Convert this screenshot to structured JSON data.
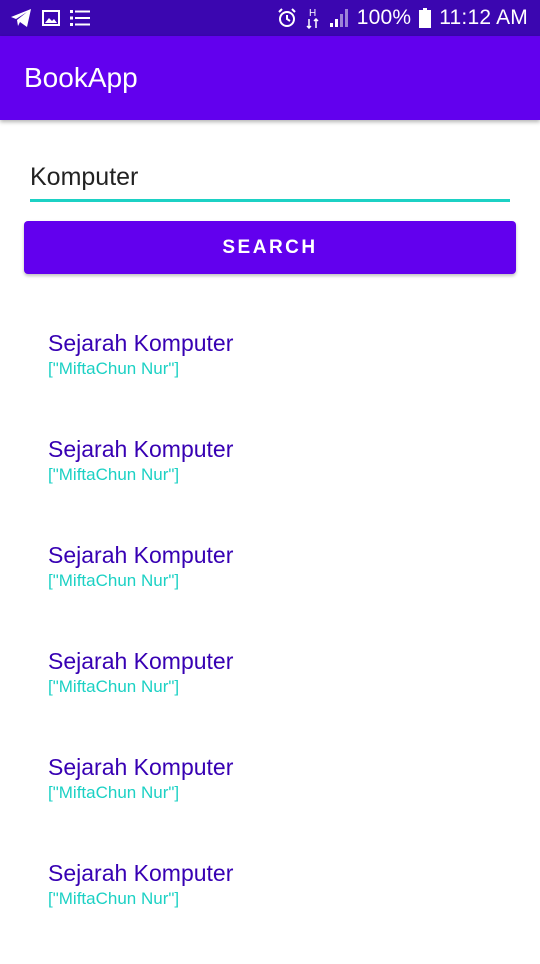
{
  "status_bar": {
    "battery_percent": "100%",
    "time": "11:12 AM",
    "network_label": "H",
    "left_icons": [
      "telegram-icon",
      "gallery-icon",
      "list-icon"
    ],
    "right_icons": [
      "alarm-icon",
      "data-arrows-icon",
      "signal-icon",
      "battery-icon"
    ]
  },
  "app_bar": {
    "title": "BookApp",
    "color": "#6200ee"
  },
  "search": {
    "value": "Komputer",
    "underline_color": "#1cd1c4",
    "button_label": "SEARCH"
  },
  "books": [
    {
      "title": "Sejarah Komputer",
      "authors": "[\"MiftaChun Nur\"]"
    },
    {
      "title": "Sejarah Komputer",
      "authors": "[\"MiftaChun Nur\"]"
    },
    {
      "title": "Sejarah Komputer",
      "authors": "[\"MiftaChun Nur\"]"
    },
    {
      "title": "Sejarah Komputer",
      "authors": "[\"MiftaChun Nur\"]"
    },
    {
      "title": "Sejarah Komputer",
      "authors": "[\"MiftaChun Nur\"]"
    },
    {
      "title": "Sejarah Komputer",
      "authors": "[\"MiftaChun Nur\"]"
    }
  ],
  "colors": {
    "status_bar": "#3b06b0",
    "primary": "#6200ee",
    "title_text": "#3700b3",
    "accent": "#1cd1c4"
  }
}
